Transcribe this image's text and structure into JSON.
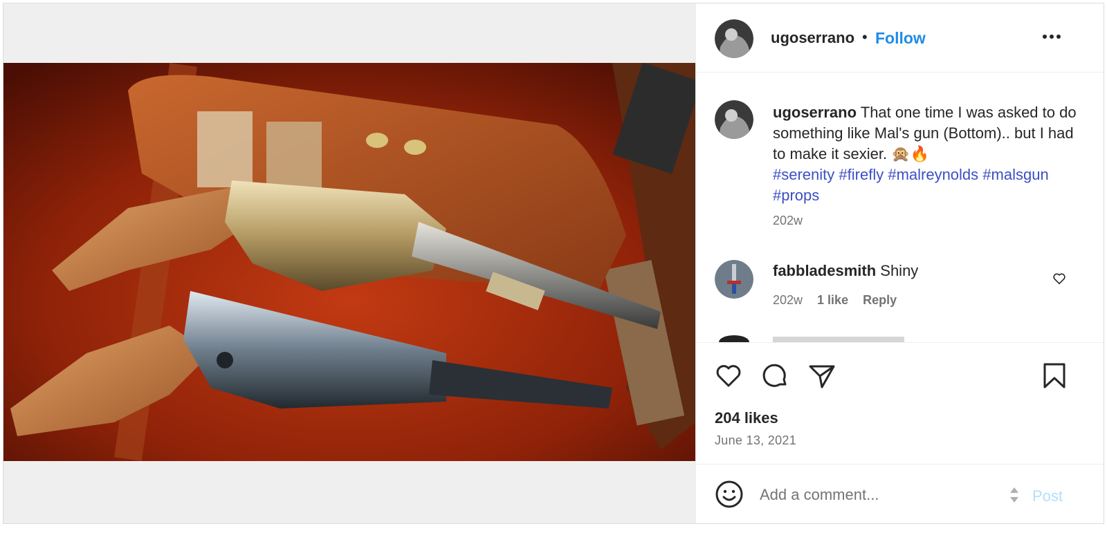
{
  "post": {
    "username": "ugoserrano",
    "separator": "•",
    "follow_label": "Follow",
    "more_icon": "more-horizontal-icon",
    "image_alt": "two revolvers on leather holster",
    "caption_text": "That one time I was asked to do something like Mal's gun (Bottom).. but I had to make it sexier. 🙊🔥",
    "hashtags": [
      "#serenity",
      "#firefly",
      "#malreynolds",
      "#malsgun",
      "#props"
    ],
    "caption_time": "202w",
    "likes": "204 likes",
    "date": "June 13, 2021"
  },
  "comments": [
    {
      "username": "fabbladesmith",
      "text": "Shiny",
      "time": "202w",
      "likes": "1 like",
      "reply_label": "Reply"
    }
  ],
  "comment_bar": {
    "placeholder": "Add a comment...",
    "post_label": "Post"
  },
  "colors": {
    "link_blue": "#1f8ce6",
    "hashtag": "#3b4fc4",
    "post_disabled": "#b2dffc",
    "muted": "#737373"
  }
}
